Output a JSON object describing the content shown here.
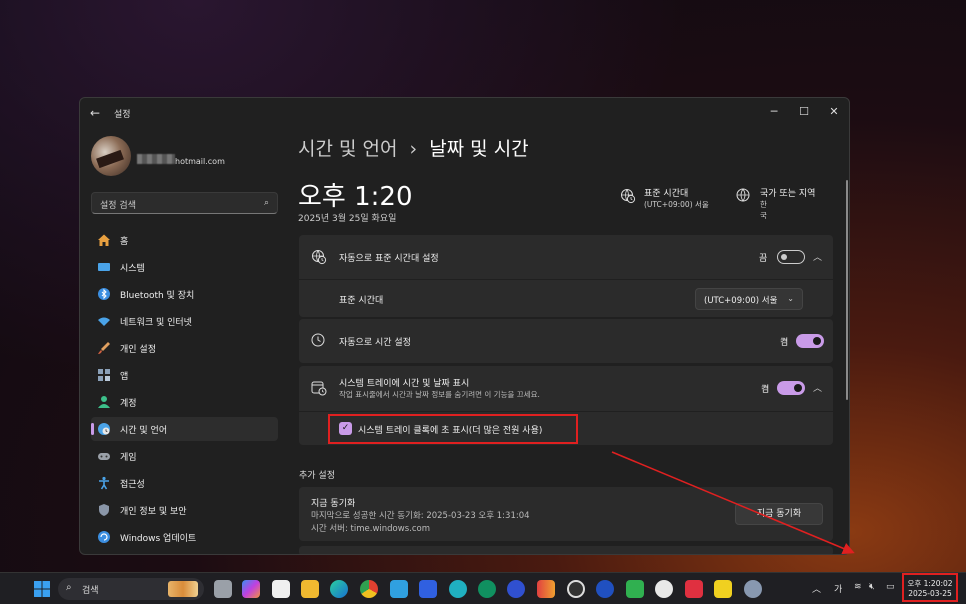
{
  "window": {
    "title": "설정",
    "controls": [
      "─",
      "☐",
      "✕"
    ]
  },
  "account": {
    "email_suffix": "hotmail.com"
  },
  "sidebar": {
    "search_placeholder": "설정 검색",
    "items": [
      {
        "label": "홈",
        "icon": "home-icon",
        "color": "#e8a040"
      },
      {
        "label": "시스템",
        "icon": "monitor-icon",
        "color": "#4aa3e8"
      },
      {
        "label": "Bluetooth 및 장치",
        "icon": "bluetooth-icon",
        "color": "#3b8ee0"
      },
      {
        "label": "네트워크 및 인터넷",
        "icon": "wifi-icon",
        "color": "#4aa3e8"
      },
      {
        "label": "개인 설정",
        "icon": "brush-icon",
        "color": "#e0a060"
      },
      {
        "label": "앱",
        "icon": "apps-icon",
        "color": "#8aa0b8"
      },
      {
        "label": "계정",
        "icon": "person-icon",
        "color": "#3cc08a"
      },
      {
        "label": "시간 및 언어",
        "icon": "globe-clock-icon",
        "color": "#4aa3e8"
      },
      {
        "label": "게임",
        "icon": "gamepad-icon",
        "color": "#9aa0a8"
      },
      {
        "label": "접근성",
        "icon": "accessibility-icon",
        "color": "#4aa3e8"
      },
      {
        "label": "개인 정보 및 보안",
        "icon": "shield-icon",
        "color": "#8a96a8"
      },
      {
        "label": "Windows 업데이트",
        "icon": "update-icon",
        "color": "#3b8ee0"
      }
    ],
    "active_index": 7
  },
  "header": {
    "breadcrumb_parent": "시간 및 언어",
    "breadcrumb_sep": "›",
    "breadcrumb_current": "날짜 및 시간",
    "time": "오후 1:20",
    "date": "2025년 3월 25일 화요일",
    "timezone_label": "표준 시간대",
    "timezone_value": "(UTC+09:00) 서울",
    "region_label": "국가 또는 지역",
    "region_value": "한국"
  },
  "settings": {
    "auto_timezone": {
      "label": "자동으로 표준 시간대 설정",
      "state": "끔",
      "on": false
    },
    "timezone_row": {
      "label": "표준 시간대",
      "value": "(UTC+09:00) 서울"
    },
    "auto_time": {
      "label": "자동으로 시간 설정",
      "state": "켬",
      "on": true
    },
    "tray_time": {
      "label": "시스템 트레이에 시간 및 날짜 표시",
      "sub": "작업 표시줄에서 시간과 날짜 정보를 숨기려면 이 기능을 끄세요.",
      "state": "켬",
      "on": true
    },
    "tray_seconds": {
      "label": "시스템 트레이 클록에 초 표시(더 많은 전원 사용)",
      "checked": true
    }
  },
  "extra": {
    "section_title": "추가 설정",
    "sync_title": "지금 동기화",
    "sync_last": "마지막으로 성공한 시간 동기화: 2025-03-23 오후 1:31:04",
    "sync_server": "시간 서버: time.windows.com",
    "sync_button": "지금 동기화"
  },
  "taskbar": {
    "search_placeholder": "검색",
    "ime": "가",
    "clock_time": "오후 1:20:02",
    "clock_date": "2025-03-25"
  },
  "colors": {
    "accent": "#c99be8",
    "highlight": "#e02020"
  }
}
